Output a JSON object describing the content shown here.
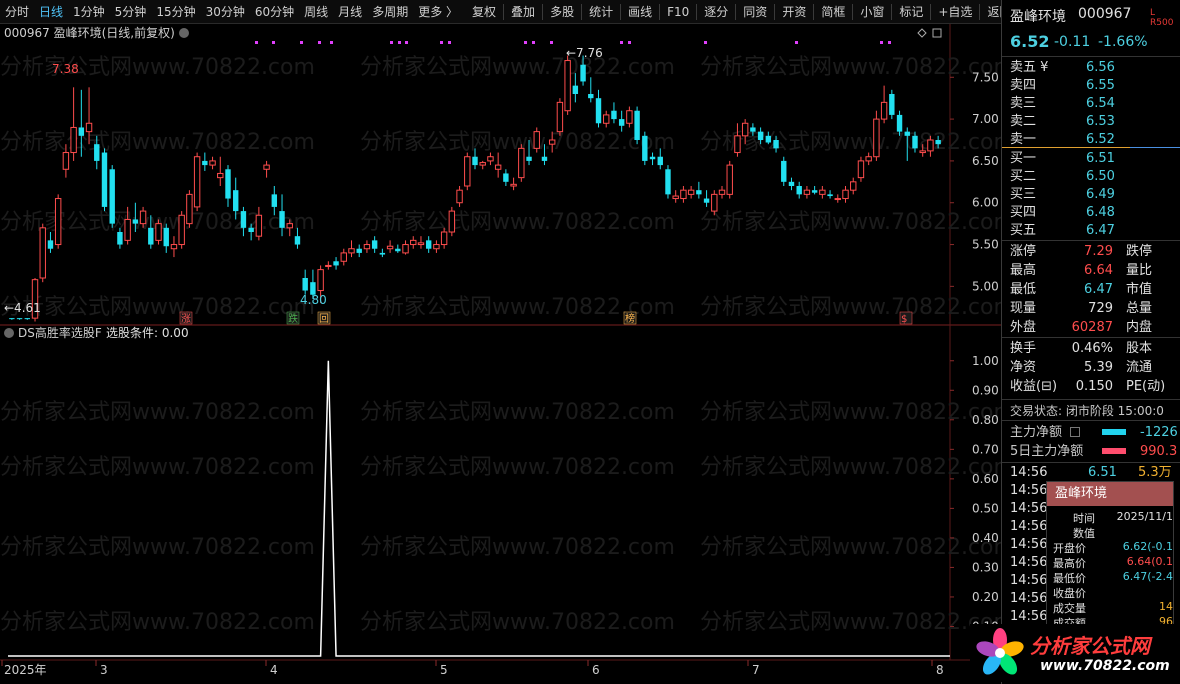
{
  "toolbar": {
    "periods": [
      "分时",
      "日线",
      "1分钟",
      "5分钟",
      "15分钟",
      "30分钟",
      "60分钟",
      "周线",
      "月线",
      "多周期",
      "更多 〉"
    ],
    "active_period": "日线",
    "actions": [
      "复权",
      "叠加",
      "多股",
      "统计",
      "画线",
      "F10",
      "逐分",
      "同资",
      "开资",
      "简框",
      "小窗",
      "标记",
      "+自选",
      "返回"
    ]
  },
  "main_chart": {
    "title": "000967 盈峰环境(日线,前复权)",
    "y_ticks": [
      "7.50",
      "7.00",
      "6.50",
      "6.00",
      "5.50",
      "5.00"
    ],
    "high_label": "7.38",
    "peak_label": "7.76",
    "low_label": "4.80",
    "start_label": "4.61",
    "markers": [
      {
        "text": "涨",
        "color": "#ff5252"
      },
      {
        "text": "跌",
        "color": "#4caf50"
      },
      {
        "text": "回",
        "color": "#ffb74d"
      },
      {
        "text": "榜",
        "color": "#ffb74d"
      },
      {
        "text": "$",
        "color": "#ff5252"
      }
    ]
  },
  "indicator": {
    "title": "DS高胜率选股F",
    "condition_label": "选股条件: 0.00",
    "y_ticks": [
      "1.00",
      "0.90",
      "0.80",
      "0.70",
      "0.60",
      "0.50",
      "0.40",
      "0.30",
      "0.20",
      "0.10"
    ]
  },
  "x_axis": {
    "labels": [
      "2025年",
      "3",
      "4",
      "5",
      "6",
      "7",
      "8"
    ]
  },
  "watermark": "分析家公式网www.70822.com",
  "quote": {
    "name": "盈峰环境",
    "code": "000967",
    "lr": "L R500",
    "price": "6.52",
    "change": "-0.11",
    "change_pct": "-1.66%",
    "asks": [
      {
        "label": "卖五 ¥",
        "price": "6.56"
      },
      {
        "label": "卖四",
        "price": "6.55"
      },
      {
        "label": "卖三",
        "price": "6.54"
      },
      {
        "label": "卖二",
        "price": "6.53"
      },
      {
        "label": "卖一",
        "price": "6.52"
      }
    ],
    "bids": [
      {
        "label": "买一",
        "price": "6.51"
      },
      {
        "label": "买二",
        "price": "6.50"
      },
      {
        "label": "买三",
        "price": "6.49"
      },
      {
        "label": "买四",
        "price": "6.48"
      },
      {
        "label": "买五",
        "price": "6.47"
      }
    ],
    "stats": [
      {
        "l1": "涨停",
        "v1": "7.29",
        "c1": "red",
        "l2": "跌停"
      },
      {
        "l1": "最高",
        "v1": "6.64",
        "c1": "red",
        "l2": "量比"
      },
      {
        "l1": "最低",
        "v1": "6.47",
        "c1": "cyan",
        "l2": "市值"
      },
      {
        "l1": "现量",
        "v1": "729",
        "c1": "white",
        "l2": "总量"
      },
      {
        "l1": "外盘",
        "v1": "60287",
        "c1": "red",
        "l2": "内盘"
      }
    ],
    "stats2": [
      {
        "l1": "换手",
        "v1": "0.46%",
        "l2": "股本"
      },
      {
        "l1": "净资",
        "v1": "5.39",
        "l2": "流通"
      },
      {
        "l1": "收益(⊟)",
        "v1": "0.150",
        "l2": "PE(动)"
      }
    ],
    "trade_status": "交易状态: 闭市阶段 15:00:0",
    "main_flow_label": "主力净额",
    "main_flow_value": "-1226",
    "flow5_label": "5日主力净额",
    "flow5_value": "990.3",
    "ticks": [
      {
        "time": "14:56",
        "price": "6.51",
        "vol": "5.3万"
      },
      {
        "time": "14:56"
      },
      {
        "time": "14:56"
      },
      {
        "time": "14:56"
      },
      {
        "time": "14:56"
      },
      {
        "time": "14:56"
      },
      {
        "time": "14:56"
      },
      {
        "time": "14:56"
      },
      {
        "time": "14:56"
      }
    ]
  },
  "tooltip": {
    "title": "盈峰环境",
    "rows": [
      {
        "k": "时间",
        "v": "2025/11/1"
      },
      {
        "k": "数值",
        "v": ""
      },
      {
        "k": "开盘价",
        "v": "6.62(-0.1"
      },
      {
        "k": "最高价",
        "v": "6.64(0.1"
      },
      {
        "k": "最低价",
        "v": "6.47(-2.4"
      },
      {
        "k": "收盘价",
        "v": ""
      },
      {
        "k": "成交量",
        "v": "14"
      },
      {
        "k": "成交额",
        "v": "96"
      }
    ]
  },
  "logo": {
    "name": "分析家公式网",
    "url": "www.70822.com"
  },
  "chart_data": {
    "type": "candlestick",
    "title": "000967 盈峰环境(日线,前复权)",
    "ylim": [
      4.55,
      7.85
    ],
    "candles": [
      [
        4.62,
        4.62,
        4.6,
        4.61
      ],
      [
        4.62,
        4.62,
        4.6,
        4.61
      ],
      [
        4.62,
        4.62,
        4.6,
        4.61
      ],
      [
        4.62,
        5.1,
        4.58,
        5.08
      ],
      [
        5.1,
        5.75,
        5.05,
        5.7
      ],
      [
        5.55,
        5.65,
        5.4,
        5.45
      ],
      [
        5.5,
        6.1,
        5.45,
        6.05
      ],
      [
        6.4,
        6.7,
        6.3,
        6.6
      ],
      [
        6.6,
        7.38,
        6.5,
        6.9
      ],
      [
        6.9,
        7.35,
        6.55,
        6.8
      ],
      [
        6.85,
        7.38,
        6.7,
        6.95
      ],
      [
        6.7,
        6.8,
        6.4,
        6.5
      ],
      [
        6.6,
        6.65,
        5.9,
        5.95
      ],
      [
        6.4,
        6.45,
        5.7,
        5.75
      ],
      [
        5.65,
        5.7,
        5.45,
        5.5
      ],
      [
        5.55,
        5.95,
        5.5,
        5.8
      ],
      [
        5.8,
        6.0,
        5.65,
        5.75
      ],
      [
        5.75,
        5.95,
        5.7,
        5.9
      ],
      [
        5.7,
        5.85,
        5.45,
        5.5
      ],
      [
        5.55,
        5.8,
        5.5,
        5.75
      ],
      [
        5.7,
        5.75,
        5.4,
        5.48
      ],
      [
        5.45,
        5.6,
        5.35,
        5.5
      ],
      [
        5.5,
        5.9,
        5.45,
        5.85
      ],
      [
        5.75,
        6.15,
        5.7,
        6.1
      ],
      [
        5.95,
        6.6,
        5.9,
        6.55
      ],
      [
        6.5,
        6.6,
        6.38,
        6.45
      ],
      [
        6.45,
        6.55,
        6.4,
        6.5
      ],
      [
        6.3,
        6.55,
        6.2,
        6.35
      ],
      [
        6.4,
        6.45,
        5.95,
        6.05
      ],
      [
        6.15,
        6.3,
        5.8,
        5.9
      ],
      [
        5.9,
        5.95,
        5.6,
        5.7
      ],
      [
        5.7,
        5.75,
        5.55,
        5.65
      ],
      [
        5.6,
        5.95,
        5.55,
        5.85
      ],
      [
        6.4,
        6.5,
        6.3,
        6.45
      ],
      [
        6.1,
        6.2,
        5.85,
        5.95
      ],
      [
        5.9,
        6.1,
        5.6,
        5.7
      ],
      [
        5.7,
        5.8,
        5.6,
        5.75
      ],
      [
        5.6,
        5.7,
        5.45,
        5.5
      ],
      [
        5.1,
        5.2,
        4.9,
        4.95
      ],
      [
        5.05,
        5.2,
        4.85,
        4.9
      ],
      [
        4.95,
        5.25,
        4.8,
        5.2
      ],
      [
        5.25,
        5.3,
        5.2,
        5.25
      ],
      [
        5.3,
        5.35,
        5.2,
        5.25
      ],
      [
        5.3,
        5.45,
        5.25,
        5.4
      ],
      [
        5.4,
        5.55,
        5.35,
        5.45
      ],
      [
        5.45,
        5.5,
        5.35,
        5.4
      ],
      [
        5.45,
        5.55,
        5.4,
        5.5
      ],
      [
        5.55,
        5.6,
        5.4,
        5.45
      ],
      [
        5.4,
        5.45,
        5.35,
        5.38
      ],
      [
        5.45,
        5.55,
        5.4,
        5.48
      ],
      [
        5.45,
        5.5,
        5.4,
        5.42
      ],
      [
        5.4,
        5.55,
        5.38,
        5.5
      ],
      [
        5.5,
        5.6,
        5.45,
        5.55
      ],
      [
        5.5,
        5.6,
        5.45,
        5.52
      ],
      [
        5.55,
        5.6,
        5.4,
        5.45
      ],
      [
        5.45,
        5.55,
        5.4,
        5.5
      ],
      [
        5.5,
        5.7,
        5.45,
        5.65
      ],
      [
        5.65,
        5.95,
        5.6,
        5.9
      ],
      [
        6.0,
        6.2,
        5.95,
        6.15
      ],
      [
        6.2,
        6.6,
        6.15,
        6.55
      ],
      [
        6.55,
        6.65,
        6.4,
        6.45
      ],
      [
        6.45,
        6.5,
        6.4,
        6.48
      ],
      [
        6.5,
        6.6,
        6.45,
        6.55
      ],
      [
        6.4,
        6.6,
        6.3,
        6.45
      ],
      [
        6.35,
        6.4,
        6.2,
        6.25
      ],
      [
        6.2,
        6.3,
        6.15,
        6.22
      ],
      [
        6.3,
        6.7,
        6.25,
        6.65
      ],
      [
        6.55,
        6.75,
        6.45,
        6.5
      ],
      [
        6.65,
        6.9,
        6.6,
        6.85
      ],
      [
        6.55,
        6.7,
        6.45,
        6.5
      ],
      [
        6.7,
        6.85,
        6.6,
        6.75
      ],
      [
        6.85,
        7.25,
        6.8,
        7.2
      ],
      [
        7.1,
        7.76,
        7.05,
        7.7
      ],
      [
        7.4,
        7.55,
        7.2,
        7.3
      ],
      [
        7.65,
        7.76,
        7.4,
        7.45
      ],
      [
        7.3,
        7.5,
        7.2,
        7.25
      ],
      [
        7.25,
        7.35,
        6.9,
        6.95
      ],
      [
        6.95,
        7.1,
        6.9,
        7.05
      ],
      [
        7.1,
        7.2,
        6.95,
        7.0
      ],
      [
        7.0,
        7.1,
        6.85,
        6.92
      ],
      [
        6.95,
        7.15,
        6.9,
        7.1
      ],
      [
        7.1,
        7.15,
        6.7,
        6.75
      ],
      [
        6.8,
        6.85,
        6.45,
        6.5
      ],
      [
        6.55,
        6.6,
        6.45,
        6.52
      ],
      [
        6.55,
        6.65,
        6.4,
        6.45
      ],
      [
        6.4,
        6.45,
        6.05,
        6.1
      ],
      [
        6.05,
        6.15,
        6.0,
        6.08
      ],
      [
        6.05,
        6.2,
        6.0,
        6.15
      ],
      [
        6.1,
        6.2,
        6.05,
        6.15
      ],
      [
        6.15,
        6.25,
        6.05,
        6.1
      ],
      [
        6.05,
        6.15,
        5.95,
        6.0
      ],
      [
        5.9,
        6.15,
        5.85,
        6.1
      ],
      [
        6.1,
        6.2,
        6.05,
        6.15
      ],
      [
        6.1,
        6.5,
        6.05,
        6.45
      ],
      [
        6.6,
        6.95,
        6.55,
        6.8
      ],
      [
        6.8,
        7.0,
        6.7,
        6.95
      ],
      [
        6.9,
        6.95,
        6.8,
        6.85
      ],
      [
        6.85,
        6.9,
        6.7,
        6.75
      ],
      [
        6.8,
        6.85,
        6.7,
        6.72
      ],
      [
        6.75,
        6.8,
        6.6,
        6.65
      ],
      [
        6.5,
        6.55,
        6.2,
        6.25
      ],
      [
        6.25,
        6.3,
        6.15,
        6.2
      ],
      [
        6.2,
        6.25,
        6.05,
        6.1
      ],
      [
        6.1,
        6.2,
        6.05,
        6.15
      ],
      [
        6.15,
        6.2,
        6.1,
        6.12
      ],
      [
        6.1,
        6.2,
        6.05,
        6.15
      ],
      [
        6.1,
        6.15,
        6.05,
        6.08
      ],
      [
        6.05,
        6.1,
        6.0,
        6.05
      ],
      [
        6.05,
        6.2,
        6.0,
        6.15
      ],
      [
        6.15,
        6.3,
        6.1,
        6.25
      ],
      [
        6.3,
        6.55,
        6.25,
        6.5
      ],
      [
        6.5,
        6.6,
        6.45,
        6.55
      ],
      [
        6.55,
        7.1,
        6.5,
        7.0
      ],
      [
        7.0,
        7.4,
        6.95,
        7.2
      ],
      [
        7.3,
        7.35,
        7.0,
        7.05
      ],
      [
        7.05,
        7.1,
        6.8,
        6.85
      ],
      [
        6.85,
        6.9,
        6.5,
        6.8
      ],
      [
        6.8,
        6.85,
        6.6,
        6.65
      ],
      [
        6.6,
        6.7,
        6.55,
        6.62
      ],
      [
        6.62,
        6.8,
        6.55,
        6.75
      ],
      [
        6.75,
        6.8,
        6.65,
        6.7
      ]
    ],
    "indicator_series": {
      "name": "选股条件",
      "ylim": [
        0,
        1.05
      ],
      "spike_index": 41,
      "spike_value": 1.0
    }
  }
}
